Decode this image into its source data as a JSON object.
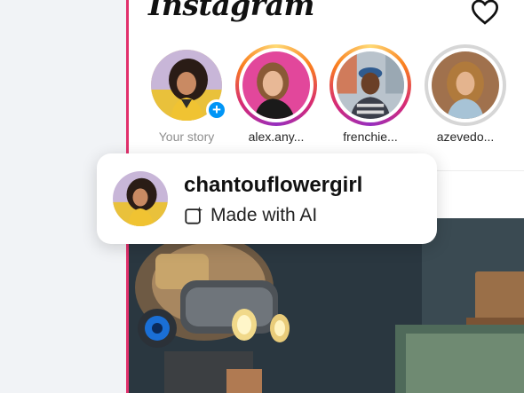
{
  "app": {
    "logo_text": "Instagram"
  },
  "header": {
    "heart_icon": "heart-outline-icon"
  },
  "stories": [
    {
      "label": "Your story",
      "ring": "none",
      "own": true
    },
    {
      "label": "alex.any...",
      "ring": "gradient"
    },
    {
      "label": "frenchie...",
      "ring": "gradient"
    },
    {
      "label": "azevedo...",
      "ring": "seen"
    }
  ],
  "tooltip": {
    "username": "chantouflowergirl",
    "ai_label": "Made with AI",
    "ai_icon": "ai-sparkle-icon"
  },
  "colors": {
    "accent_pink": "#e1306c",
    "blue": "#0095f6",
    "story_gradient": [
      "#feda75",
      "#fa7e1e",
      "#d62976",
      "#962fbf"
    ]
  }
}
